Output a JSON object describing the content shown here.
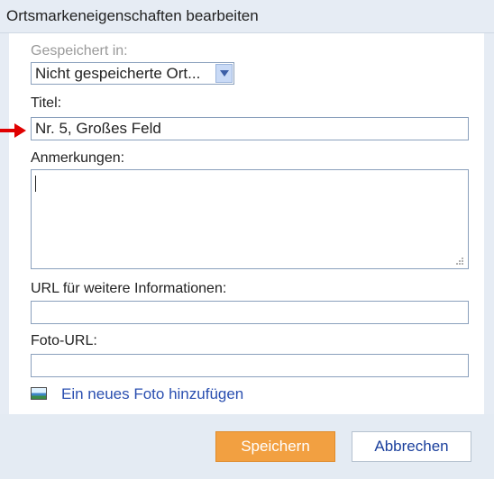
{
  "dialog": {
    "title": "Ortsmarkeneigenschaften bearbeiten"
  },
  "saved_in": {
    "label": "Gespeichert in:",
    "selected": "Nicht gespeicherte Ort..."
  },
  "title_field": {
    "label": "Titel:",
    "value": "Nr. 5, Großes Feld"
  },
  "notes": {
    "label": "Anmerkungen:",
    "value": ""
  },
  "url_field": {
    "label": "URL für weitere Informationen:",
    "value": ""
  },
  "photo_url": {
    "label": "Foto-URL:",
    "value": ""
  },
  "add_photo": {
    "label": "Ein neues Foto hinzufügen"
  },
  "buttons": {
    "save": "Speichern",
    "cancel": "Abbrechen"
  },
  "colors": {
    "accent_save": "#f2a041",
    "link": "#2a4fb0",
    "pointer": "#e00000"
  }
}
